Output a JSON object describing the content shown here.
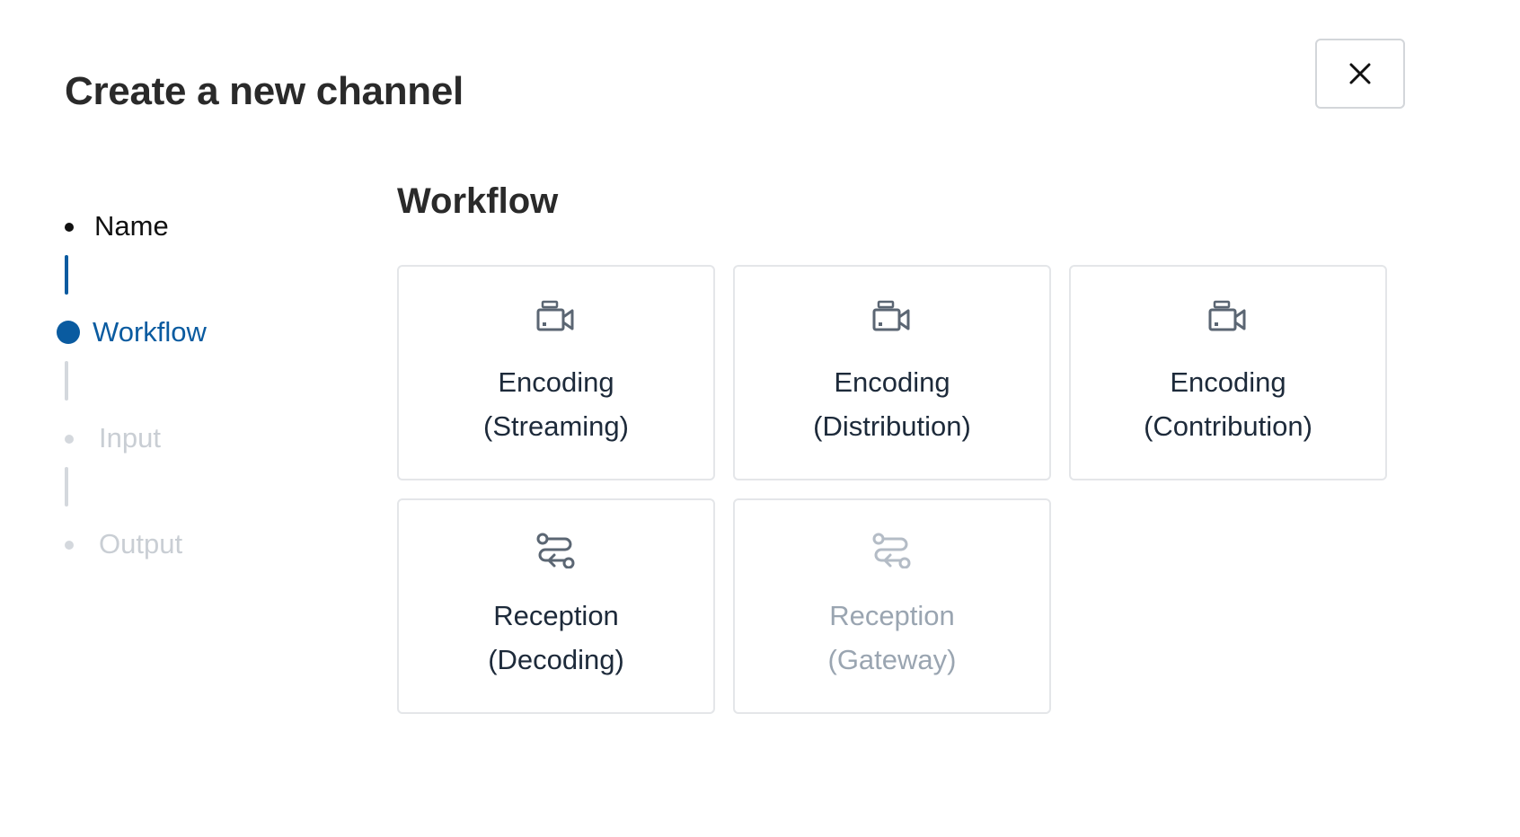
{
  "dialog": {
    "title": "Create a new channel",
    "close_icon": "close-icon"
  },
  "stepper": {
    "steps": [
      {
        "label": "Name",
        "state": "completed"
      },
      {
        "label": "Workflow",
        "state": "active"
      },
      {
        "label": "Input",
        "state": "pending"
      },
      {
        "label": "Output",
        "state": "pending"
      }
    ]
  },
  "workflow": {
    "title": "Workflow",
    "options": [
      {
        "line1": "Encoding",
        "line2": "(Streaming)",
        "icon": "video-camera-icon",
        "enabled": true
      },
      {
        "line1": "Encoding",
        "line2": "(Distribution)",
        "icon": "video-camera-icon",
        "enabled": true
      },
      {
        "line1": "Encoding",
        "line2": "(Contribution)",
        "icon": "video-camera-icon",
        "enabled": true
      },
      {
        "line1": "Reception",
        "line2": "(Decoding)",
        "icon": "route-icon",
        "enabled": true
      },
      {
        "line1": "Reception",
        "line2": "(Gateway)",
        "icon": "route-icon",
        "enabled": false
      }
    ]
  },
  "colors": {
    "accent": "#0a5ba0",
    "completed": "#111111",
    "pending": "#c9ced4",
    "icon": "#5b6673",
    "icon_disabled": "#b4bcc6"
  }
}
